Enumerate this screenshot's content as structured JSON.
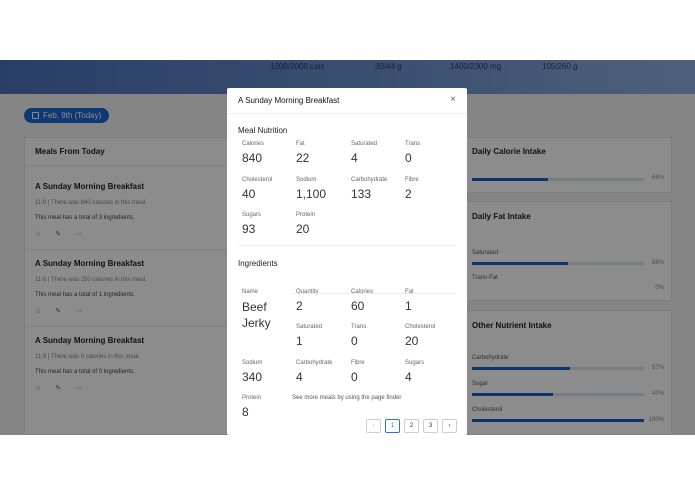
{
  "background": {
    "hero_stats": [
      "1200/2000 cals",
      "30/44 g",
      "1400/2300 mg",
      "105/260 g"
    ],
    "date_pill": "Feb. 9th (Today)",
    "meals_card": {
      "title": "Meals From Today",
      "meals": [
        {
          "title": "A Sunday Morning Breakfast",
          "subtitle": "11:0 | There was 840 calories in this meal.",
          "info": "This meal has a total of 3 ingredients."
        },
        {
          "title": "A Sunday Morning Breakfast",
          "subtitle": "11:6 | There was 250 calories in this meal.",
          "info": "This meal has a total of 1 ingredients."
        },
        {
          "title": "A Sunday Morning Breakfast",
          "subtitle": "11:9 | There was 0 calories in this meal.",
          "info": "This meal has a total of 0 ingredients."
        }
      ],
      "actions": {
        "star": "☆",
        "edit": "✎",
        "more": "⋯"
      }
    },
    "calorie_card": {
      "title": "Daily Calorie Intake",
      "percent_label": "64%",
      "percent": 0.44
    },
    "fat_card": {
      "title": "Daily Fat Intake",
      "rows": [
        {
          "label": "Saturated",
          "percent_label": "56%",
          "percent": 0.56
        },
        {
          "label": "Trans-Fat",
          "percent_label": "0%",
          "percent": 0
        }
      ]
    },
    "other_card": {
      "title": "Other Nutrient Intake",
      "rows": [
        {
          "label": "Carbohydrate",
          "percent_label": "57%",
          "percent": 0.57
        },
        {
          "label": "Sugar",
          "percent_label": "47%",
          "percent": 0.47
        },
        {
          "label": "Cholesterol",
          "percent_label": "100%",
          "percent": 1.0
        }
      ]
    }
  },
  "modal": {
    "title": "A Sunday Morning Breakfast",
    "close_label": "×",
    "meal_nutrition": {
      "heading": "Meal Nutrition",
      "items": [
        {
          "label": "Calories",
          "value": "840"
        },
        {
          "label": "Fat",
          "value": "22"
        },
        {
          "label": "Saturated",
          "value": "4"
        },
        {
          "label": "Trans",
          "value": "0"
        },
        {
          "label": "Cholesterol",
          "value": "40"
        },
        {
          "label": "Sodium",
          "value": "1,100"
        },
        {
          "label": "Carbohydrate",
          "value": "133"
        },
        {
          "label": "Fibre",
          "value": "2"
        },
        {
          "label": "Sugars",
          "value": "93"
        },
        {
          "label": "Protein",
          "value": "20"
        }
      ]
    },
    "ingredients": {
      "heading": "Ingredients",
      "items": [
        {
          "label": "Name",
          "value": "Beef Jerky"
        },
        {
          "label": "Quantity",
          "value": "2"
        },
        {
          "label": "Calories",
          "value": "60"
        },
        {
          "label": "Fat",
          "value": "1"
        },
        {
          "label": "Saturated",
          "value": "1"
        },
        {
          "label": "Trans",
          "value": "0"
        },
        {
          "label": "Cholesterol",
          "value": "20"
        },
        {
          "label": "Sodium",
          "value": "340"
        },
        {
          "label": "Carbohydrate",
          "value": "4"
        },
        {
          "label": "Fibre",
          "value": "0"
        },
        {
          "label": "Sugars",
          "value": "4"
        },
        {
          "label": "Protein",
          "value": "8"
        }
      ]
    },
    "hint": "See more meals by using the page finder",
    "pagination": {
      "prev": "‹",
      "pages": [
        "1",
        "2",
        "3"
      ],
      "active": "1",
      "next": "›"
    }
  },
  "colors": {
    "accent": "#1a66d2",
    "bar_fill": "#1a5fc9",
    "overlay": "rgba(0,0,0,0.45)"
  }
}
